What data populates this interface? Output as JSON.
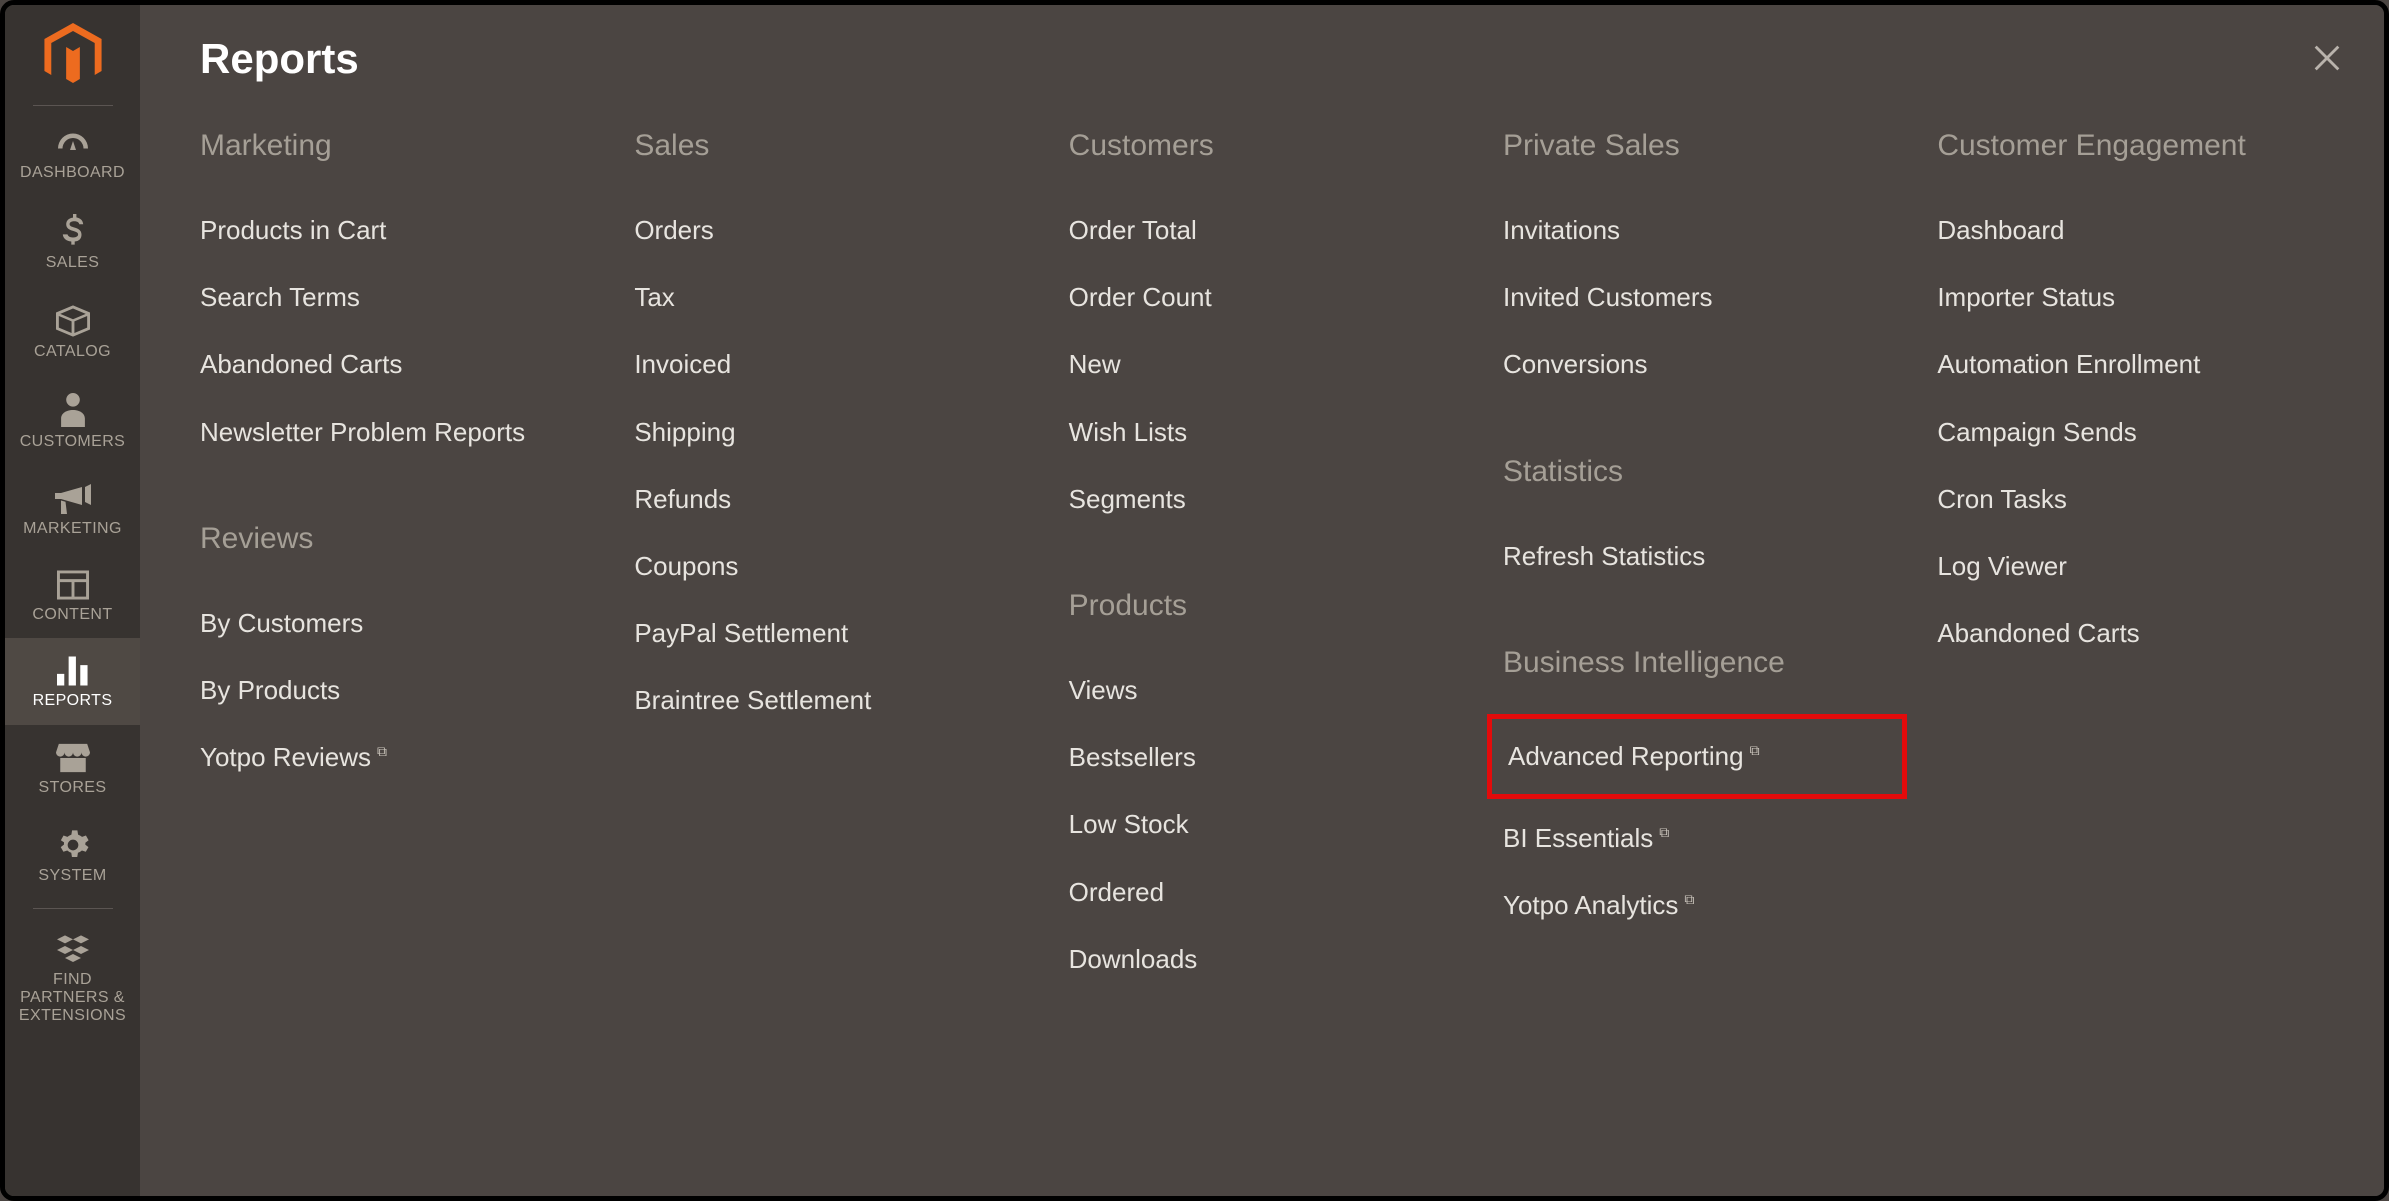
{
  "sidebar": {
    "items": [
      {
        "id": "dashboard",
        "label": "DASHBOARD"
      },
      {
        "id": "sales",
        "label": "SALES"
      },
      {
        "id": "catalog",
        "label": "CATALOG"
      },
      {
        "id": "customers",
        "label": "CUSTOMERS"
      },
      {
        "id": "marketing",
        "label": "MARKETING"
      },
      {
        "id": "content",
        "label": "CONTENT"
      },
      {
        "id": "reports",
        "label": "REPORTS"
      },
      {
        "id": "stores",
        "label": "STORES"
      },
      {
        "id": "system",
        "label": "SYSTEM"
      },
      {
        "id": "partners",
        "label": "FIND PARTNERS & EXTENSIONS"
      }
    ]
  },
  "flyout": {
    "title": "Reports",
    "columns": {
      "marketing": {
        "heading": "Marketing",
        "items": [
          "Products in Cart",
          "Search Terms",
          "Abandoned Carts",
          "Newsletter Problem Reports"
        ]
      },
      "reviews": {
        "heading": "Reviews",
        "items": [
          "By Customers",
          "By Products",
          "Yotpo Reviews"
        ],
        "external": [
          false,
          false,
          true
        ]
      },
      "sales": {
        "heading": "Sales",
        "items": [
          "Orders",
          "Tax",
          "Invoiced",
          "Shipping",
          "Refunds",
          "Coupons",
          "PayPal Settlement",
          "Braintree Settlement"
        ]
      },
      "customers": {
        "heading": "Customers",
        "items": [
          "Order Total",
          "Order Count",
          "New",
          "Wish Lists",
          "Segments"
        ]
      },
      "products": {
        "heading": "Products",
        "items": [
          "Views",
          "Bestsellers",
          "Low Stock",
          "Ordered",
          "Downloads"
        ]
      },
      "private_sales": {
        "heading": "Private Sales",
        "items": [
          "Invitations",
          "Invited Customers",
          "Conversions"
        ]
      },
      "statistics": {
        "heading": "Statistics",
        "items": [
          "Refresh Statistics"
        ]
      },
      "business_intelligence": {
        "heading": "Business Intelligence",
        "items": [
          "Advanced Reporting",
          "BI Essentials",
          "Yotpo Analytics"
        ],
        "external": [
          true,
          true,
          true
        ],
        "highlight_index": 0
      },
      "customer_engagement": {
        "heading": "Customer Engagement",
        "items": [
          "Dashboard",
          "Importer Status",
          "Automation Enrollment",
          "Campaign Sends",
          "Cron Tasks",
          "Log Viewer",
          "Abandoned Carts"
        ]
      }
    }
  }
}
